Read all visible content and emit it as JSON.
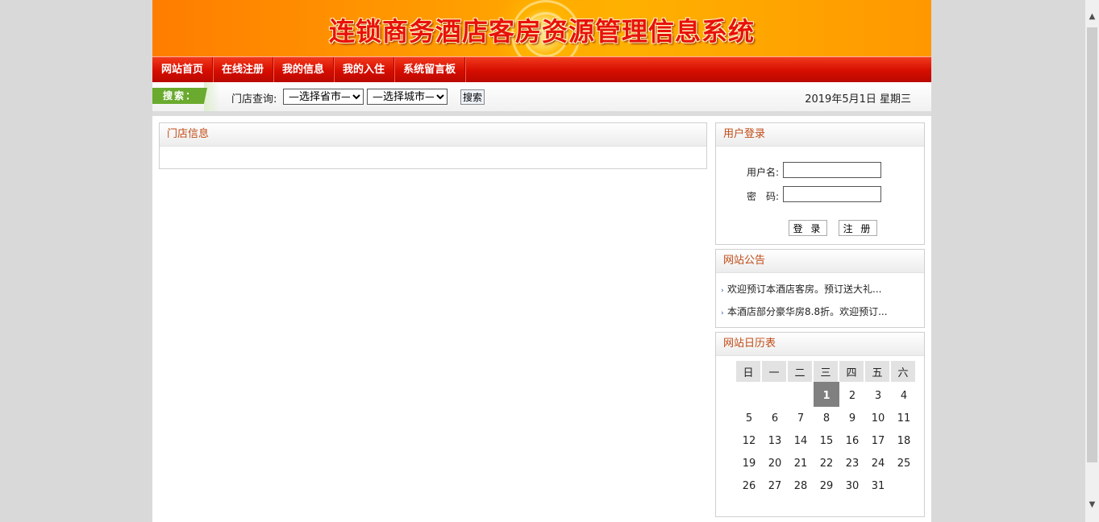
{
  "banner": {
    "title": "连锁商务酒店客房资源管理信息系统"
  },
  "nav": {
    "items": [
      "网站首页",
      "在线注册",
      "我的信息",
      "我的入住",
      "系统留言板"
    ]
  },
  "search": {
    "tag": "搜索：",
    "store_label": "门店查询:",
    "province_selected": "—选择省市—",
    "city_selected": "—选择城市—",
    "button": "搜索",
    "date": "2019年5月1日 星期三"
  },
  "store_panel": {
    "title": "门店信息"
  },
  "login": {
    "title": "用户登录",
    "username_label": "用户名:",
    "password_label": "密　码:",
    "username_value": "",
    "password_value": "",
    "login_button": "登 录",
    "register_button": "注 册"
  },
  "notice": {
    "title": "网站公告",
    "items": [
      "欢迎预订本酒店客房。预订送大礼...",
      "本酒店部分豪华房8.8折。欢迎预订..."
    ]
  },
  "calendar": {
    "title": "网站日历表",
    "weekdays": [
      "日",
      "一",
      "二",
      "三",
      "四",
      "五",
      "六"
    ],
    "today": "1",
    "weeks": [
      [
        "",
        "",
        "",
        "1",
        "2",
        "3",
        "4"
      ],
      [
        "5",
        "6",
        "7",
        "8",
        "9",
        "10",
        "11"
      ],
      [
        "12",
        "13",
        "14",
        "15",
        "16",
        "17",
        "18"
      ],
      [
        "19",
        "20",
        "21",
        "22",
        "23",
        "24",
        "25"
      ],
      [
        "26",
        "27",
        "28",
        "29",
        "30",
        "31",
        ""
      ]
    ]
  },
  "colors": {
    "nav_red": "#d50d00",
    "banner_orange": "#ff9a00",
    "title_red": "#e8120a",
    "panel_title": "#c14b15",
    "search_tag_green": "#6aaa2e"
  }
}
